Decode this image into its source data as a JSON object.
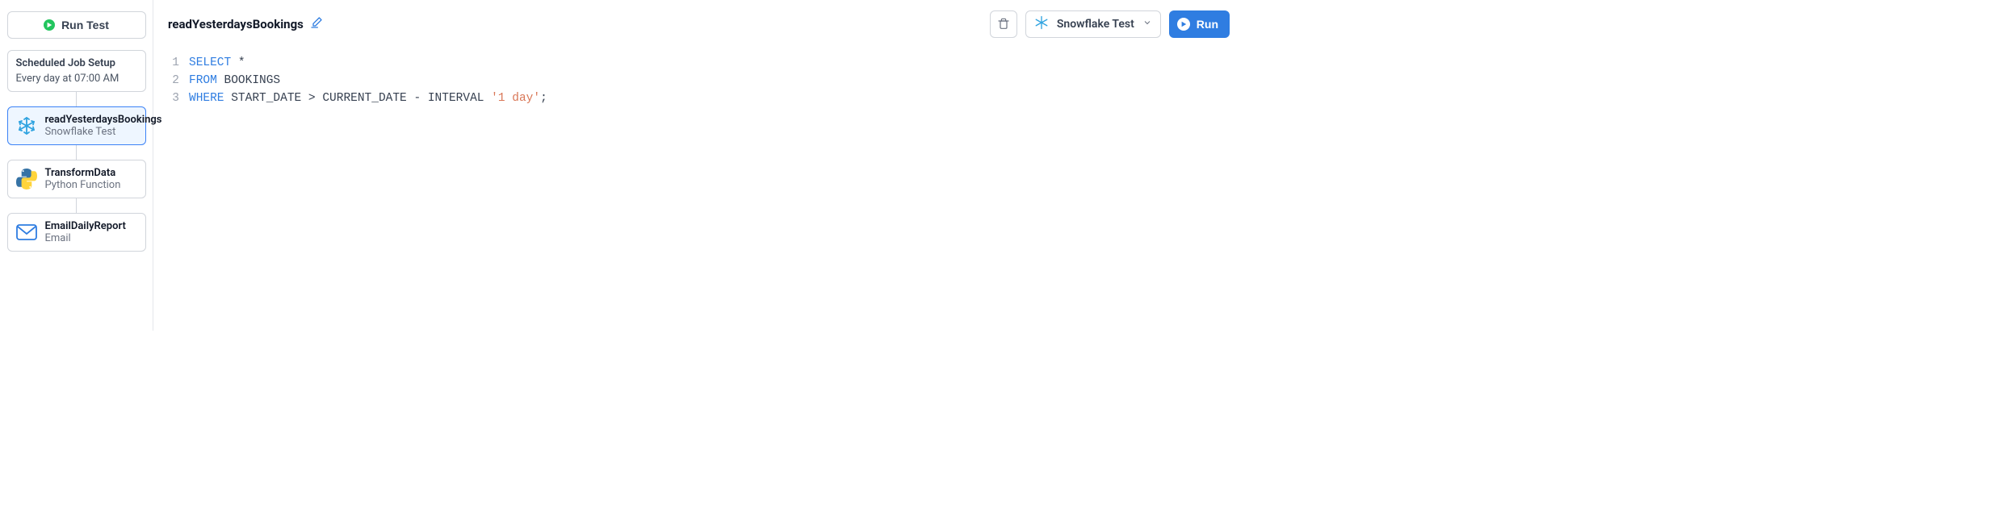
{
  "sidebar": {
    "runTestLabel": "Run Test",
    "schedule": {
      "title": "Scheduled Job Setup",
      "subtitle": "Every day at 07:00 AM"
    },
    "steps": [
      {
        "title": "readYesterdaysBookings",
        "subtitle": "Snowflake Test"
      },
      {
        "title": "TransformData",
        "subtitle": "Python Function"
      },
      {
        "title": "EmailDailyReport",
        "subtitle": "Email"
      }
    ]
  },
  "header": {
    "title": "readYesterdaysBookings",
    "connection": "Snowflake Test",
    "runLabel": "Run"
  },
  "code": {
    "lines": [
      {
        "n": "1",
        "tokens": [
          {
            "t": "SELECT",
            "c": "kw"
          },
          {
            "t": " *",
            "c": "txt"
          }
        ]
      },
      {
        "n": "2",
        "tokens": [
          {
            "t": "FROM",
            "c": "kw"
          },
          {
            "t": " BOOKINGS",
            "c": "txt"
          }
        ]
      },
      {
        "n": "3",
        "tokens": [
          {
            "t": "WHERE",
            "c": "kw"
          },
          {
            "t": " START_DATE > CURRENT_DATE - INTERVAL ",
            "c": "txt"
          },
          {
            "t": "'1 day'",
            "c": "str"
          },
          {
            "t": ";",
            "c": "txt"
          }
        ]
      }
    ]
  }
}
